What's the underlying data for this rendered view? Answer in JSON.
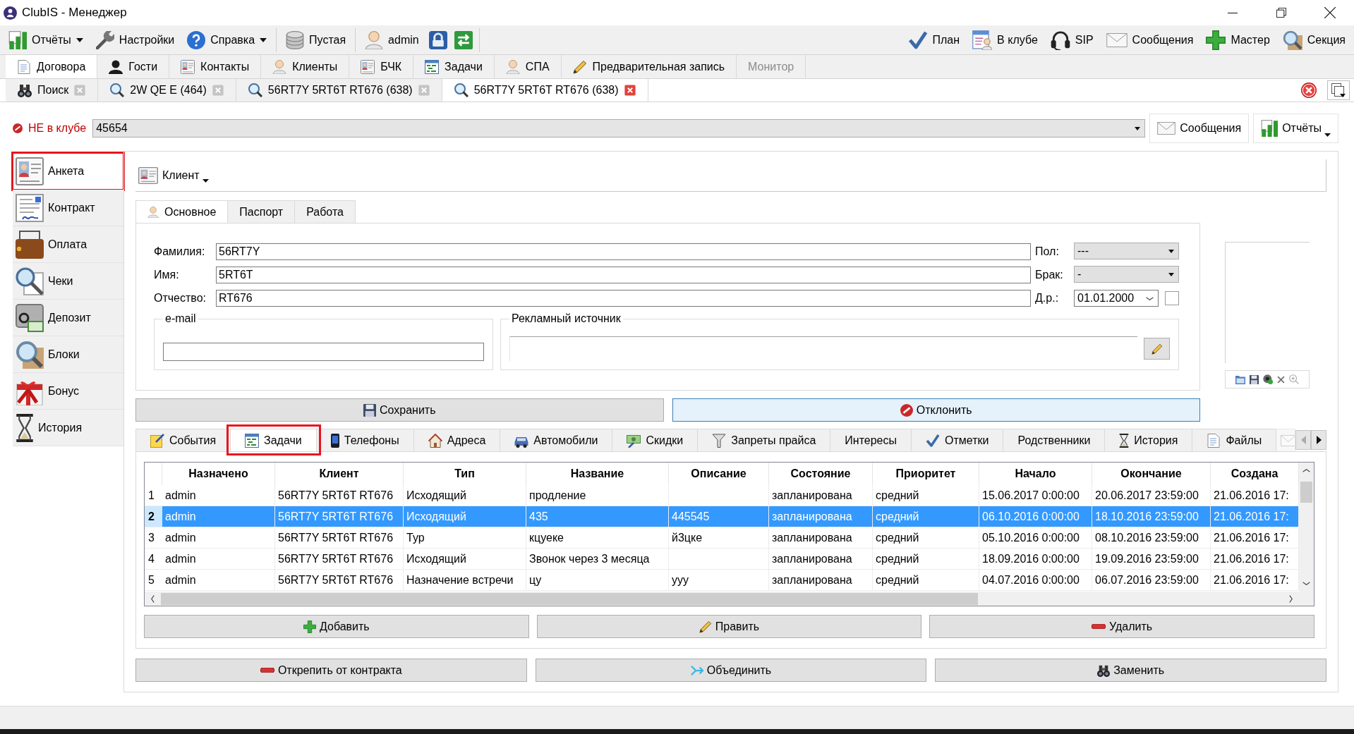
{
  "window": {
    "title": "ClubIS - Менеджер"
  },
  "toolbar": {
    "left_groups": [
      [
        {
          "label": "Отчёты",
          "menu": true
        },
        {
          "label": "Настройки",
          "menu": false
        },
        {
          "label": "Справка",
          "menu": true
        }
      ],
      [
        {
          "label": "Пустая",
          "menu": false
        }
      ],
      [
        {
          "label": "admin",
          "menu": false
        }
      ]
    ],
    "right": [
      {
        "label": "План"
      },
      {
        "label": "В клубе"
      },
      {
        "label": "SIP"
      },
      {
        "label": "Сообщения"
      },
      {
        "label": "Мастер"
      },
      {
        "label": "Секция"
      }
    ]
  },
  "module_tabs": [
    {
      "label": "Договора",
      "selected": true,
      "disabled": false
    },
    {
      "label": "Гости",
      "selected": false,
      "disabled": false
    },
    {
      "label": "Контакты",
      "selected": false,
      "disabled": false
    },
    {
      "label": "Клиенты",
      "selected": false,
      "disabled": false
    },
    {
      "label": "БЧК",
      "selected": false,
      "disabled": false
    },
    {
      "label": "Задачи",
      "selected": false,
      "disabled": false
    },
    {
      "label": "СПА",
      "selected": false,
      "disabled": false
    },
    {
      "label": "Предварительная запись",
      "selected": false,
      "disabled": false
    },
    {
      "label": "Монитор",
      "selected": false,
      "disabled": true
    }
  ],
  "document_tabs": [
    {
      "label": "Поиск",
      "selected": false
    },
    {
      "label": "2W QE E (464)",
      "selected": false
    },
    {
      "label": "56RT7Y 5RT6T RT676 (638)",
      "selected": false
    },
    {
      "label": "56RT7Y 5RT6T RT676 (638)",
      "selected": true
    }
  ],
  "client_bar": {
    "status": "НЕ в клубе",
    "client_number": "45654",
    "buttons": [
      {
        "label": "Сообщения",
        "menu": false
      },
      {
        "label": "Отчёты",
        "menu": true
      }
    ]
  },
  "sidebar": {
    "items": [
      {
        "label": "Анкета",
        "selected": true,
        "highlighted": true
      },
      {
        "label": "Контракт",
        "selected": false,
        "highlighted": false
      },
      {
        "label": "Оплата",
        "selected": false,
        "highlighted": false
      },
      {
        "label": "Чеки",
        "selected": false,
        "highlighted": false
      },
      {
        "label": "Депозит",
        "selected": false,
        "highlighted": false
      },
      {
        "label": "Блоки",
        "selected": false,
        "highlighted": false
      },
      {
        "label": "Бонус",
        "selected": false,
        "highlighted": false
      },
      {
        "label": "История",
        "selected": false,
        "highlighted": false
      }
    ]
  },
  "card": {
    "title": "Клиент",
    "tabs": [
      {
        "label": "Основное",
        "selected": true
      },
      {
        "label": "Паспорт",
        "selected": false
      },
      {
        "label": "Работа",
        "selected": false
      }
    ],
    "name_fields": [
      {
        "label": "Фамилия:",
        "value": "56RT7Y"
      },
      {
        "label": "Имя:",
        "value": "5RT6T"
      },
      {
        "label": "Отчество:",
        "value": "RT676"
      }
    ],
    "side_fields": [
      {
        "label": "Пол:",
        "value": "---",
        "kind": "combo"
      },
      {
        "label": "Брак:",
        "value": "-",
        "kind": "combo"
      },
      {
        "label": "Д.р.:",
        "value": "01.01.2000",
        "kind": "date"
      }
    ],
    "dob_checkbox": {
      "checked": false
    },
    "email": {
      "label": "e-mail"
    },
    "ad_source": {
      "label": "Рекламный источник"
    },
    "save_button": "Сохранить",
    "reject_button": "Отклонить"
  },
  "detail_tabs": {
    "tabs": [
      {
        "label": "События",
        "selected": false,
        "highlighted": false
      },
      {
        "label": "Задачи",
        "selected": true,
        "highlighted": true
      },
      {
        "label": "Телефоны",
        "selected": false,
        "highlighted": false
      },
      {
        "label": "Адреса",
        "selected": false,
        "highlighted": false
      },
      {
        "label": "Автомобили",
        "selected": false,
        "highlighted": false
      },
      {
        "label": "Скидки",
        "selected": false,
        "highlighted": false
      },
      {
        "label": "Запреты прайса",
        "selected": false,
        "highlighted": false
      },
      {
        "label": "Интересы",
        "selected": false,
        "highlighted": false
      },
      {
        "label": "Отметки",
        "selected": false,
        "highlighted": false
      },
      {
        "label": "Родственники",
        "selected": false,
        "highlighted": false
      },
      {
        "label": "История",
        "selected": false,
        "highlighted": false
      },
      {
        "label": "Файлы",
        "selected": false,
        "highlighted": false
      }
    ],
    "table": {
      "columns": [
        "Назначено",
        "Клиент",
        "Тип",
        "Название",
        "Описание",
        "Состояние",
        "Приоритет",
        "Начало",
        "Окончание",
        "Создана"
      ],
      "rows": [
        {
          "number": "1",
          "selected": false,
          "assigned": "admin",
          "client": "56RT7Y 5RT6T RT676",
          "type": "Исходящий",
          "title": "продление",
          "state": "запланирована",
          "priority": "средний",
          "start": "15.06.2017 0:00:00",
          "end": "20.06.2017 23:59:00",
          "created": "21.06.2016 17:"
        },
        {
          "number": "2",
          "selected": true,
          "assigned": "admin",
          "client": "56RT7Y 5RT6T RT676",
          "type": "Исходящий",
          "title": "435",
          "description": "445545",
          "state": "запланирована",
          "priority": "средний",
          "start": "06.10.2016 0:00:00",
          "end": "18.10.2016 23:59:00",
          "created": "21.06.2016 17:"
        },
        {
          "number": "3",
          "selected": false,
          "assigned": "admin",
          "client": "56RT7Y 5RT6T RT676",
          "type": "Тур",
          "title": "кцуеке",
          "description": "й3цке",
          "state": "запланирована",
          "priority": "средний",
          "start": "05.10.2016 0:00:00",
          "end": "08.10.2016 23:59:00",
          "created": "21.06.2016 17:"
        },
        {
          "number": "4",
          "selected": false,
          "assigned": "admin",
          "client": "56RT7Y 5RT6T RT676",
          "type": "Исходящий",
          "title": "Звонок через 3 месяца",
          "state": "запланирована",
          "priority": "средний",
          "start": "18.09.2016 0:00:00",
          "end": "19.09.2016 23:59:00",
          "created": "21.06.2016 17:"
        },
        {
          "number": "5",
          "selected": false,
          "assigned": "admin",
          "client": "56RT7Y 5RT6T RT676",
          "type": "Назначение встречи",
          "title": "цу",
          "description": "ууу",
          "state": "запланирована",
          "priority": "средний",
          "start": "04.07.2016 0:00:00",
          "end": "06.07.2016 23:59:00",
          "created": "21.06.2016 17:"
        }
      ]
    },
    "actions": [
      "Добавить",
      "Править",
      "Удалить"
    ]
  },
  "bottom_buttons": [
    "Открепить от контракта",
    "Объединить",
    "Заменить"
  ]
}
